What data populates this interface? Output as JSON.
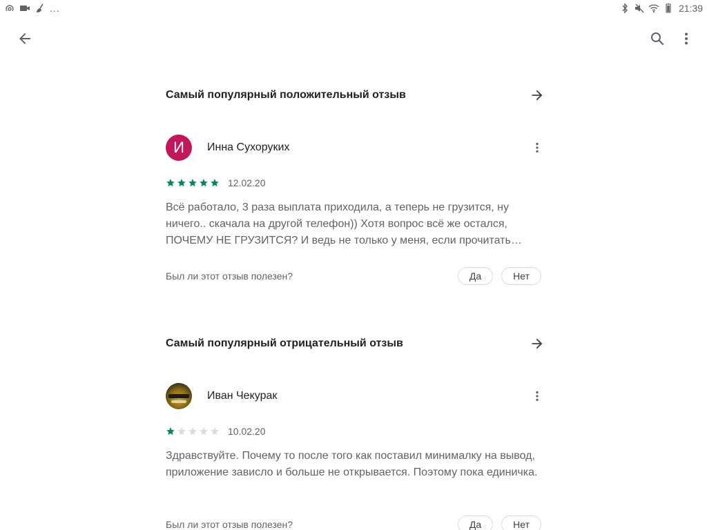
{
  "status_bar": {
    "left_more": "...",
    "time": "21:39"
  },
  "toolbar": {
    "back_icon": "arrow-back-icon",
    "search_icon": "search-icon",
    "menu_icon": "more-vert-icon"
  },
  "colors": {
    "star_filled": "#01875f",
    "star_empty": "#dadce0",
    "avatar_inna": "#c2185b"
  },
  "sections": [
    {
      "title": "Самый популярный положительный отзыв",
      "review": {
        "avatar_letter": "И",
        "name": "Инна Сухоруких",
        "rating": 5,
        "date": "12.02.20",
        "text": "Всё работало, 3 раза выплата приходила, а теперь не грузится, ну ничего.. скачала на другой телефон)) Хотя вопрос всё же остался, ПОЧЕМУ НЕ ГРУЗИТСЯ? И ведь не только у меня, если прочитать другие отзывы",
        "helpful_question": "Был ли этот отзыв полезен?",
        "yes": "Да",
        "no": "Нет"
      }
    },
    {
      "title": "Самый популярный отрицательный отзыв",
      "review": {
        "name": "Иван Чекурак",
        "rating": 1,
        "date": "10.02.20",
        "text": "Здравствуйте. Почему то после того как поставил минималку на вывод, приложение зависло и больше не открывается. Поэтому пока единичка.",
        "helpful_question": "Был ли этот отзыв полезен?",
        "yes": "Да",
        "no": "Нет"
      }
    }
  ]
}
